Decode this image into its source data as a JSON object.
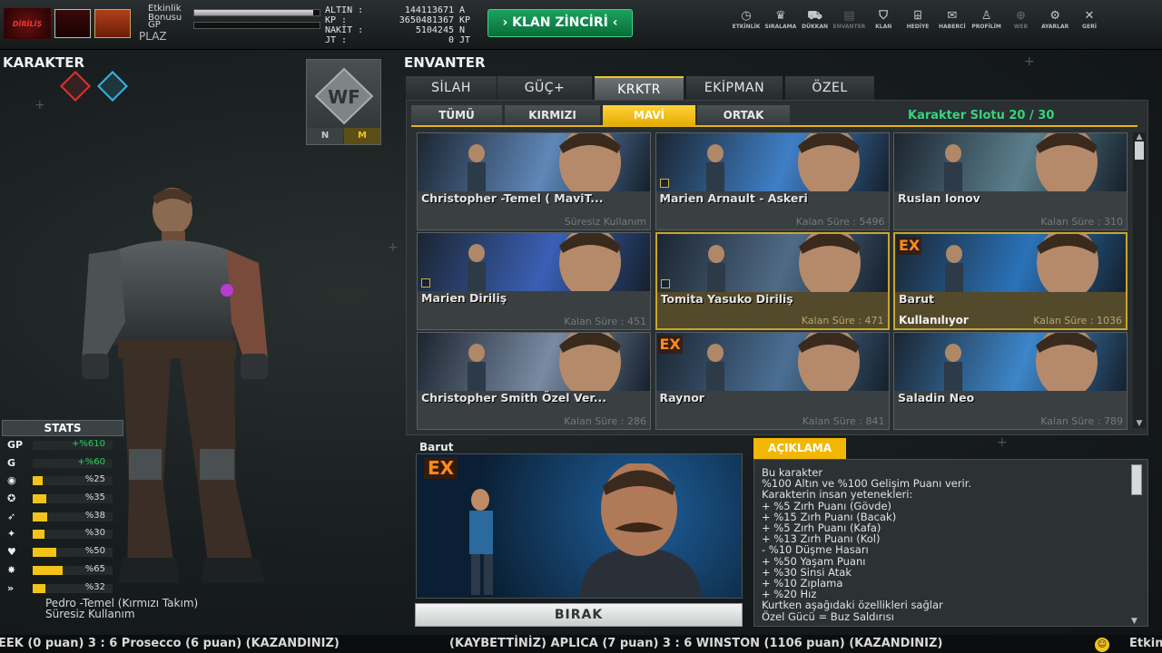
{
  "topbar": {
    "logo_text": "DİRİLİŞ",
    "bonus_label": "Etkinlik Bonusu",
    "bonus_fill": 0.95,
    "gp_label": "GP",
    "gp_fill": 0.0,
    "rank_label": "PLAZ",
    "currencies": [
      {
        "label": "ALTIN",
        "value": "144113671",
        "unit": "A"
      },
      {
        "label": "KP",
        "value": "3650481367",
        "unit": "KP"
      },
      {
        "label": "NAKİT",
        "value": "5104245",
        "unit": "N"
      },
      {
        "label": "JT",
        "value": "0",
        "unit": "JT"
      }
    ],
    "klan_button": "KLAN ZİNCİRİ",
    "icons": [
      {
        "label": "ETKİNLİK",
        "icon": "clock-icon",
        "glyph": "◷",
        "dim": false
      },
      {
        "label": "SIRALAMA",
        "icon": "laurel-icon",
        "glyph": "♛",
        "dim": false
      },
      {
        "label": "DÜKKAN",
        "icon": "cart-icon",
        "glyph": "⛟",
        "dim": false
      },
      {
        "label": "ENVANTER",
        "icon": "inventory-icon",
        "glyph": "▤",
        "dim": true
      },
      {
        "label": "KLAN",
        "icon": "shield-icon",
        "glyph": "⛉",
        "dim": false
      },
      {
        "label": "HEDİYE",
        "icon": "gift-icon",
        "glyph": "⌹",
        "dim": false
      },
      {
        "label": "HABERCİ",
        "icon": "megaphone-icon",
        "glyph": "✉",
        "dim": false
      },
      {
        "label": "PROFİLİM",
        "icon": "profile-icon",
        "glyph": "♙",
        "dim": false
      },
      {
        "label": "WEB",
        "icon": "globe-icon",
        "glyph": "⊕",
        "dim": true
      },
      {
        "label": "AYARLAR",
        "icon": "gear-icon",
        "glyph": "⚙",
        "dim": false
      },
      {
        "label": "GERİ",
        "icon": "back-icon",
        "glyph": "✕",
        "dim": false
      }
    ]
  },
  "left": {
    "title": "KARAKTER",
    "stats_title": "STATS",
    "stats": [
      {
        "icon": "GP",
        "value": "+%610",
        "fill": 0,
        "color": "green"
      },
      {
        "icon": "G",
        "value": "+%60",
        "fill": 0,
        "color": "green"
      },
      {
        "icon": "◉",
        "value": "%25",
        "fill": 0.12,
        "color": "yellow"
      },
      {
        "icon": "✪",
        "value": "%35",
        "fill": 0.17,
        "color": "yellow"
      },
      {
        "icon": "➶",
        "value": "%38",
        "fill": 0.18,
        "color": "yellow"
      },
      {
        "icon": "✦",
        "value": "%30",
        "fill": 0.15,
        "color": "yellow"
      },
      {
        "icon": "♥",
        "value": "%50",
        "fill": 0.3,
        "color": "yellow"
      },
      {
        "icon": "✸",
        "value": "%65",
        "fill": 0.38,
        "color": "yellow"
      },
      {
        "icon": "»",
        "value": "%32",
        "fill": 0.16,
        "color": "yellow"
      }
    ],
    "char_name": "Pedro -Temel (Kırmızı Takım)",
    "char_duration": "Süresiz Kullanım",
    "portrait_modes": [
      "N",
      "M"
    ]
  },
  "inventory": {
    "title": "ENVANTER",
    "tabs": [
      "SİLAH",
      "GÜÇ+",
      "KRKTR",
      "EKİPMAN",
      "ÖZEL"
    ],
    "active_tab": 2,
    "subtabs": [
      "TÜMÜ",
      "KIRMIZI",
      "MAVİ",
      "ORTAK"
    ],
    "active_subtab": 2,
    "slot_text": "Karakter Slotu 20 / 30",
    "cards": [
      {
        "name": "Christopher -Temel ( MaviT...",
        "time": "Süresiz Kullanım",
        "ex": "",
        "badge": false,
        "selected": false,
        "use": "",
        "hue": "#5f87b8"
      },
      {
        "name": "Marien Arnault - Askeri",
        "time": "Kalan Süre : 5496",
        "ex": "",
        "badge": true,
        "selected": false,
        "use": "",
        "hue": "#3f7fc6"
      },
      {
        "name": "Ruslan Ionov",
        "time": "Kalan Süre : 310",
        "ex": "",
        "badge": false,
        "selected": false,
        "use": "",
        "hue": "#5c7f8d"
      },
      {
        "name": "Marien Diriliş",
        "time": "Kalan Süre : 451",
        "ex": "",
        "badge": true,
        "selected": false,
        "use": "",
        "hue": "#3a5fb5"
      },
      {
        "name": "Tomita Yasuko Diriliş",
        "time": "Kalan Süre : 471",
        "ex": "",
        "badge": true,
        "selected": true,
        "use": "",
        "hue": "#506a86"
      },
      {
        "name": "Barut",
        "time": "Kalan Süre : 1036",
        "ex": "EX",
        "badge": false,
        "selected": true,
        "use": "Kullanılıyor",
        "hue": "#2a72b8"
      },
      {
        "name": "Christopher Smith Özel Ver...",
        "time": "Kalan Süre : 286",
        "ex": "",
        "badge": false,
        "selected": false,
        "use": "",
        "hue": "#7a8aa2"
      },
      {
        "name": "Raynor",
        "time": "Kalan Süre : 841",
        "ex": "EX",
        "badge": false,
        "selected": false,
        "use": "",
        "hue": "#4b6f94"
      },
      {
        "name": "Saladin Neo",
        "time": "Kalan Süre : 789",
        "ex": "",
        "badge": false,
        "selected": false,
        "use": "",
        "hue": "#3d86c9"
      }
    ]
  },
  "detail": {
    "title": "Barut",
    "ex": "EX",
    "release_button": "BIRAK",
    "desc_tab": "AÇIKLAMA",
    "desc_lines": [
      "Bu karakter",
      "%100 Altın ve %100 Gelişim Puanı verir.",
      "Karakterin insan yetenekleri:",
      "+ %5  Zırh Puanı (Gövde)",
      "+ %15 Zırh Puanı (Bacak)",
      "+ %5 Zırh Puanı (Kafa)",
      "+ %13 Zırh Puanı (Kol)",
      "- %10 Düşme Hasarı",
      "+ %50 Yaşam Puanı",
      "+ %30 Sinsi Atak",
      "+ %10 Zıplama",
      "+ %20 Hız",
      "Kurtken aşağıdaki özellikleri sağlar",
      "Özel Gücü = Buz Saldırısı"
    ]
  },
  "ticker": {
    "left": "EEK (0 puan) 3 : 6 Prosecco (6 puan) (KAZANDINIZ)",
    "right": "(KAYBETTİNİZ) APLICA (7 puan) 3 : 6 WINSTON (1106 puan) (KAZANDINIZ)",
    "end": "Etkin"
  }
}
